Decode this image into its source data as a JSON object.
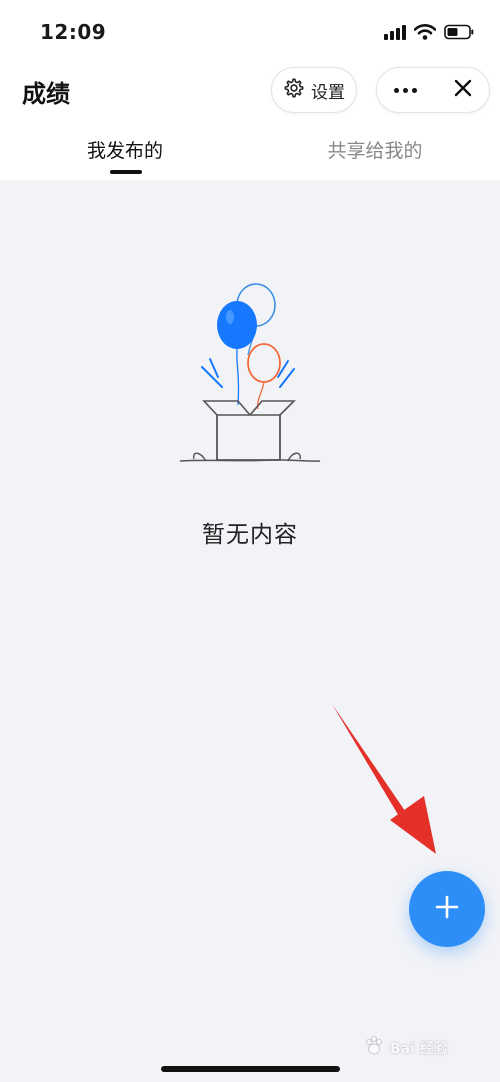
{
  "status_bar": {
    "time": "12:09"
  },
  "nav": {
    "title": "成绩",
    "settings_label": "设置"
  },
  "tabs": [
    {
      "label": "我发布的",
      "active": true
    },
    {
      "label": "共享给我的",
      "active": false
    }
  ],
  "empty_state": {
    "text": "暂无内容"
  },
  "colors": {
    "accent": "#2e8ef7",
    "background": "#f2f3f7",
    "arrow": "#e5302a",
    "balloon_blue": "#1677ff",
    "balloon_orange": "#f06a3c"
  },
  "icons": {
    "settings": "gear-icon",
    "more": "ellipsis-icon",
    "close": "close-icon",
    "add": "plus-icon"
  },
  "watermark": {
    "text": "Bai 经验"
  }
}
